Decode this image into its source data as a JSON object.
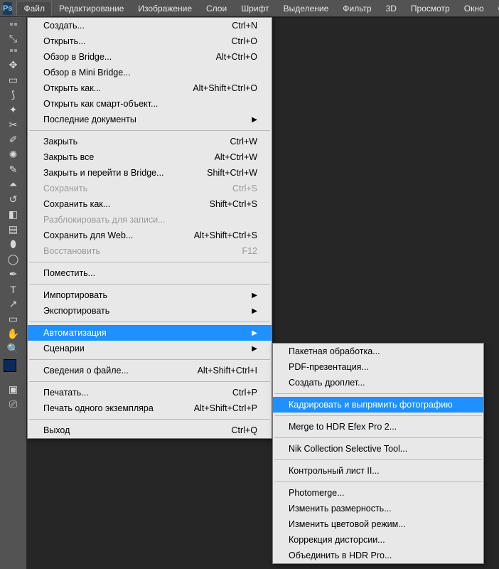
{
  "menubar": {
    "logo": "Ps",
    "items": [
      "Файл",
      "Редактирование",
      "Изображение",
      "Слои",
      "Шрифт",
      "Выделение",
      "Фильтр",
      "3D",
      "Просмотр",
      "Окно",
      "Справка"
    ],
    "active_index": 0
  },
  "file_menu": [
    {
      "label": "Создать...",
      "shortcut": "Ctrl+N"
    },
    {
      "label": "Открыть...",
      "shortcut": "Ctrl+O"
    },
    {
      "label": "Обзор в Bridge...",
      "shortcut": "Alt+Ctrl+O"
    },
    {
      "label": "Обзор в Mini Bridge..."
    },
    {
      "label": "Открыть как...",
      "shortcut": "Alt+Shift+Ctrl+O"
    },
    {
      "label": "Открыть как смарт-объект..."
    },
    {
      "label": "Последние документы",
      "submenu": true
    },
    {
      "sep": true
    },
    {
      "label": "Закрыть",
      "shortcut": "Ctrl+W"
    },
    {
      "label": "Закрыть все",
      "shortcut": "Alt+Ctrl+W"
    },
    {
      "label": "Закрыть и перейти в Bridge...",
      "shortcut": "Shift+Ctrl+W"
    },
    {
      "label": "Сохранить",
      "shortcut": "Ctrl+S",
      "disabled": true
    },
    {
      "label": "Сохранить как...",
      "shortcut": "Shift+Ctrl+S"
    },
    {
      "label": "Разблокировать для записи...",
      "disabled": true
    },
    {
      "label": "Сохранить для Web...",
      "shortcut": "Alt+Shift+Ctrl+S"
    },
    {
      "label": "Восстановить",
      "shortcut": "F12",
      "disabled": true
    },
    {
      "sep": true
    },
    {
      "label": "Поместить..."
    },
    {
      "sep": true
    },
    {
      "label": "Импортировать",
      "submenu": true
    },
    {
      "label": "Экспортировать",
      "submenu": true
    },
    {
      "sep": true
    },
    {
      "label": "Автоматизация",
      "submenu": true,
      "highlight": true
    },
    {
      "label": "Сценарии",
      "submenu": true
    },
    {
      "sep": true
    },
    {
      "label": "Сведения о файле...",
      "shortcut": "Alt+Shift+Ctrl+I"
    },
    {
      "sep": true
    },
    {
      "label": "Печатать...",
      "shortcut": "Ctrl+P"
    },
    {
      "label": "Печать одного экземпляра",
      "shortcut": "Alt+Shift+Ctrl+P"
    },
    {
      "sep": true
    },
    {
      "label": "Выход",
      "shortcut": "Ctrl+Q"
    }
  ],
  "automate_menu": [
    {
      "label": "Пакетная обработка..."
    },
    {
      "label": "PDF-презентация..."
    },
    {
      "label": "Создать дроплет..."
    },
    {
      "sep": true
    },
    {
      "label": "Кадрировать и выпрямить фотографию",
      "highlight": true
    },
    {
      "sep": true
    },
    {
      "label": "Merge to HDR Efex Pro 2..."
    },
    {
      "sep": true
    },
    {
      "label": "Nik Collection Selective Tool..."
    },
    {
      "sep": true
    },
    {
      "label": "Контрольный лист II..."
    },
    {
      "sep": true
    },
    {
      "label": "Photomerge..."
    },
    {
      "label": "Изменить размерность..."
    },
    {
      "label": "Изменить цветовой режим..."
    },
    {
      "label": "Коррекция дисторсии..."
    },
    {
      "label": "Объединить в HDR Pro..."
    }
  ],
  "tools": [
    {
      "name": "move-tool",
      "glyph": "✥"
    },
    {
      "name": "marquee-tool",
      "glyph": "▭"
    },
    {
      "name": "lasso-tool",
      "glyph": "⟆"
    },
    {
      "name": "wand-tool",
      "glyph": "✦"
    },
    {
      "name": "crop-tool",
      "glyph": "✂"
    },
    {
      "name": "eyedropper-tool",
      "glyph": "✐"
    },
    {
      "name": "spot-heal-tool",
      "glyph": "✺"
    },
    {
      "name": "brush-tool",
      "glyph": "✎"
    },
    {
      "name": "stamp-tool",
      "glyph": "⏶"
    },
    {
      "name": "history-brush-tool",
      "glyph": "↺"
    },
    {
      "name": "eraser-tool",
      "glyph": "◧"
    },
    {
      "name": "gradient-tool",
      "glyph": "▤"
    },
    {
      "name": "blur-tool",
      "glyph": "⬮"
    },
    {
      "name": "dodge-tool",
      "glyph": "◯"
    },
    {
      "name": "pen-tool",
      "glyph": "✒"
    },
    {
      "name": "type-tool",
      "glyph": "T"
    },
    {
      "name": "path-tool",
      "glyph": "↗"
    },
    {
      "name": "shape-tool",
      "glyph": "▭"
    },
    {
      "name": "hand-tool",
      "glyph": "✋"
    },
    {
      "name": "zoom-tool",
      "glyph": "🔍"
    }
  ]
}
